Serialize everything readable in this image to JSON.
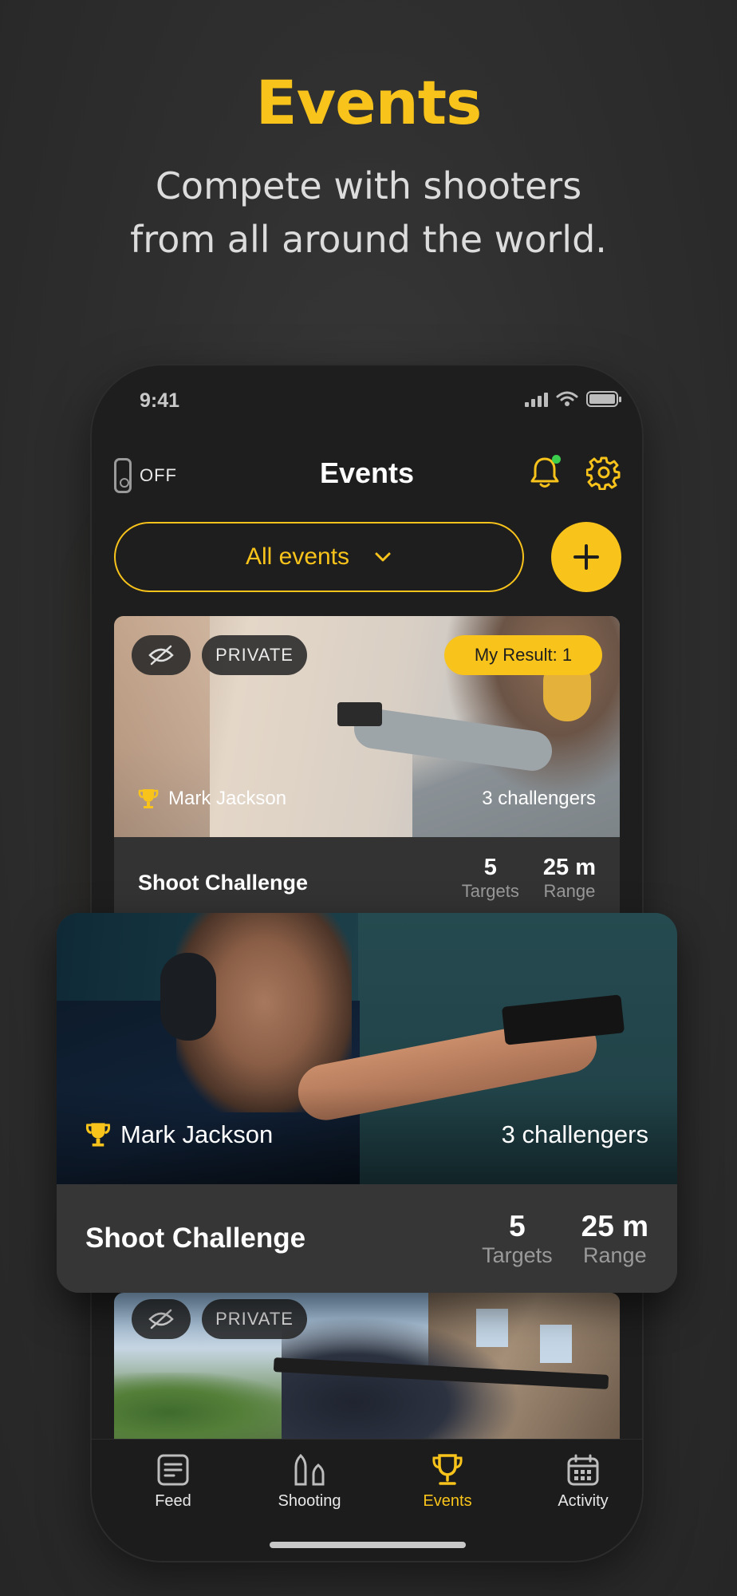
{
  "hero": {
    "title": "Events",
    "subtitle": "Compete with shooters\nfrom all around the world."
  },
  "status_bar": {
    "time": "9:41"
  },
  "nav": {
    "device_status": "OFF",
    "title": "Events"
  },
  "filter": {
    "selected": "All events"
  },
  "cards": [
    {
      "visibility_badge": "PRIVATE",
      "my_result": "My Result: 1",
      "winner": "Mark Jackson",
      "challengers": "3 challengers",
      "title": "Shoot Challenge",
      "targets_value": "5",
      "targets_label": "Targets",
      "range_value": "25 m",
      "range_label": "Range"
    },
    {
      "winner": "Mark Jackson",
      "challengers": "3 challengers",
      "title": "Shoot Challenge",
      "targets_value": "5",
      "targets_label": "Targets",
      "range_value": "25 m",
      "range_label": "Range"
    },
    {
      "visibility_badge": "PRIVATE"
    }
  ],
  "tab_bar": {
    "tabs": [
      {
        "label": "Feed",
        "icon": "feed-icon"
      },
      {
        "label": "Shooting",
        "icon": "bullets-icon"
      },
      {
        "label": "Events",
        "icon": "trophy-icon",
        "active": true
      },
      {
        "label": "Activity",
        "icon": "calendar-icon"
      }
    ]
  },
  "colors": {
    "accent": "#f8c31b",
    "background": "#2f2f2f",
    "card": "#333333",
    "notification_dot": "#3ccf4e"
  }
}
